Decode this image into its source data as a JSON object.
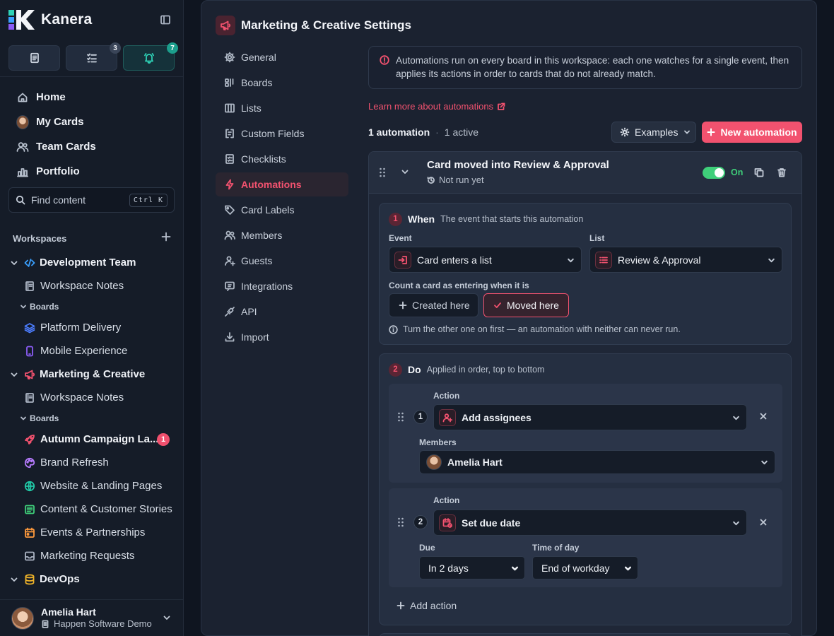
{
  "app": {
    "name": "Kanera",
    "quick_badges": {
      "tasks": "3",
      "notifications": "7"
    }
  },
  "sidebar": {
    "nav": [
      {
        "label": "Home",
        "icon": "home-icon"
      },
      {
        "label": "My Cards",
        "icon": "avatar"
      },
      {
        "label": "Team Cards",
        "icon": "users-icon"
      },
      {
        "label": "Portfolio",
        "icon": "bar-chart-icon"
      }
    ],
    "search": {
      "placeholder": "Find content",
      "shortcut": "Ctrl K"
    },
    "workspaces_label": "Workspaces",
    "workspaces": [
      {
        "name": "Development Team",
        "icon": "code-icon",
        "color": "#3aa0ff",
        "notes": "Workspace Notes",
        "boards_label": "Boards",
        "boards": [
          {
            "name": "Platform Delivery",
            "icon": "layers-icon",
            "color": "#4c7dff"
          },
          {
            "name": "Mobile Experience",
            "icon": "phone-icon",
            "color": "#8b5cf6"
          }
        ]
      },
      {
        "name": "Marketing & Creative",
        "icon": "megaphone-icon",
        "color": "#f2526f",
        "notes": "Workspace Notes",
        "boards_label": "Boards",
        "boards": [
          {
            "name": "Autumn Campaign La...",
            "icon": "rocket-icon",
            "color": "#f2526f",
            "badge": "1"
          },
          {
            "name": "Brand Refresh",
            "icon": "palette-icon",
            "color": "#b77cff"
          },
          {
            "name": "Website & Landing Pages",
            "icon": "globe-icon",
            "color": "#20c7a5"
          },
          {
            "name": "Content & Customer Stories",
            "icon": "doc-list-icon",
            "color": "#3fcf7a"
          },
          {
            "name": "Events & Partnerships",
            "icon": "calendar-icon",
            "color": "#ff9a3c"
          },
          {
            "name": "Marketing Requests",
            "icon": "inbox-icon",
            "color": "#aab3c2"
          }
        ]
      },
      {
        "name": "DevOps",
        "icon": "database-icon",
        "color": "#f0b429"
      }
    ],
    "user": {
      "name": "Amelia Hart",
      "org": "Happen Software Demo"
    }
  },
  "settings": {
    "title": "Marketing & Creative Settings",
    "nav": [
      {
        "label": "General",
        "icon": "gear-icon"
      },
      {
        "label": "Boards",
        "icon": "boards-icon"
      },
      {
        "label": "Lists",
        "icon": "columns-icon"
      },
      {
        "label": "Custom Fields",
        "icon": "fields-icon"
      },
      {
        "label": "Checklists",
        "icon": "checklist-icon"
      },
      {
        "label": "Automations",
        "icon": "bolt-icon",
        "active": true
      },
      {
        "label": "Card Labels",
        "icon": "tag-icon"
      },
      {
        "label": "Members",
        "icon": "users-icon"
      },
      {
        "label": "Guests",
        "icon": "user-plus-icon"
      },
      {
        "label": "Integrations",
        "icon": "plug-icon"
      },
      {
        "label": "API",
        "icon": "api-icon"
      },
      {
        "label": "Import",
        "icon": "download-icon"
      }
    ],
    "notice": "Automations run on every board in this workspace: each one watches for a single event, then applies its actions in order to cards that do not already match.",
    "learn_link": "Learn more about automations",
    "summary": {
      "count": "1 automation",
      "active": "1 active"
    },
    "examples_label": "Examples",
    "new_label": "New automation"
  },
  "automation": {
    "title": "Card moved into Review & Approval",
    "status": "Not run yet",
    "toggle_label": "On",
    "when": {
      "number": "1",
      "title": "When",
      "desc": "The event that starts this automation",
      "event_label": "Event",
      "event_value": "Card enters a list",
      "list_label": "List",
      "list_value": "Review & Approval",
      "count_label": "Count a card as entering when it is",
      "option_created": "Created here",
      "option_moved": "Moved here",
      "hint": "Turn the other one on first — an automation with neither can never run."
    },
    "do": {
      "number": "2",
      "title": "Do",
      "desc": "Applied in order, top to bottom",
      "actions": [
        {
          "step": "1",
          "action_label": "Action",
          "action_value": "Add assignees",
          "members_label": "Members",
          "member": "Amelia Hart"
        },
        {
          "step": "2",
          "action_label": "Action",
          "action_value": "Set due date",
          "due_label": "Due",
          "due_value": "In 2 days",
          "time_label": "Time of day",
          "time_value": "End of workday"
        }
      ],
      "add_action": "Add action"
    }
  }
}
